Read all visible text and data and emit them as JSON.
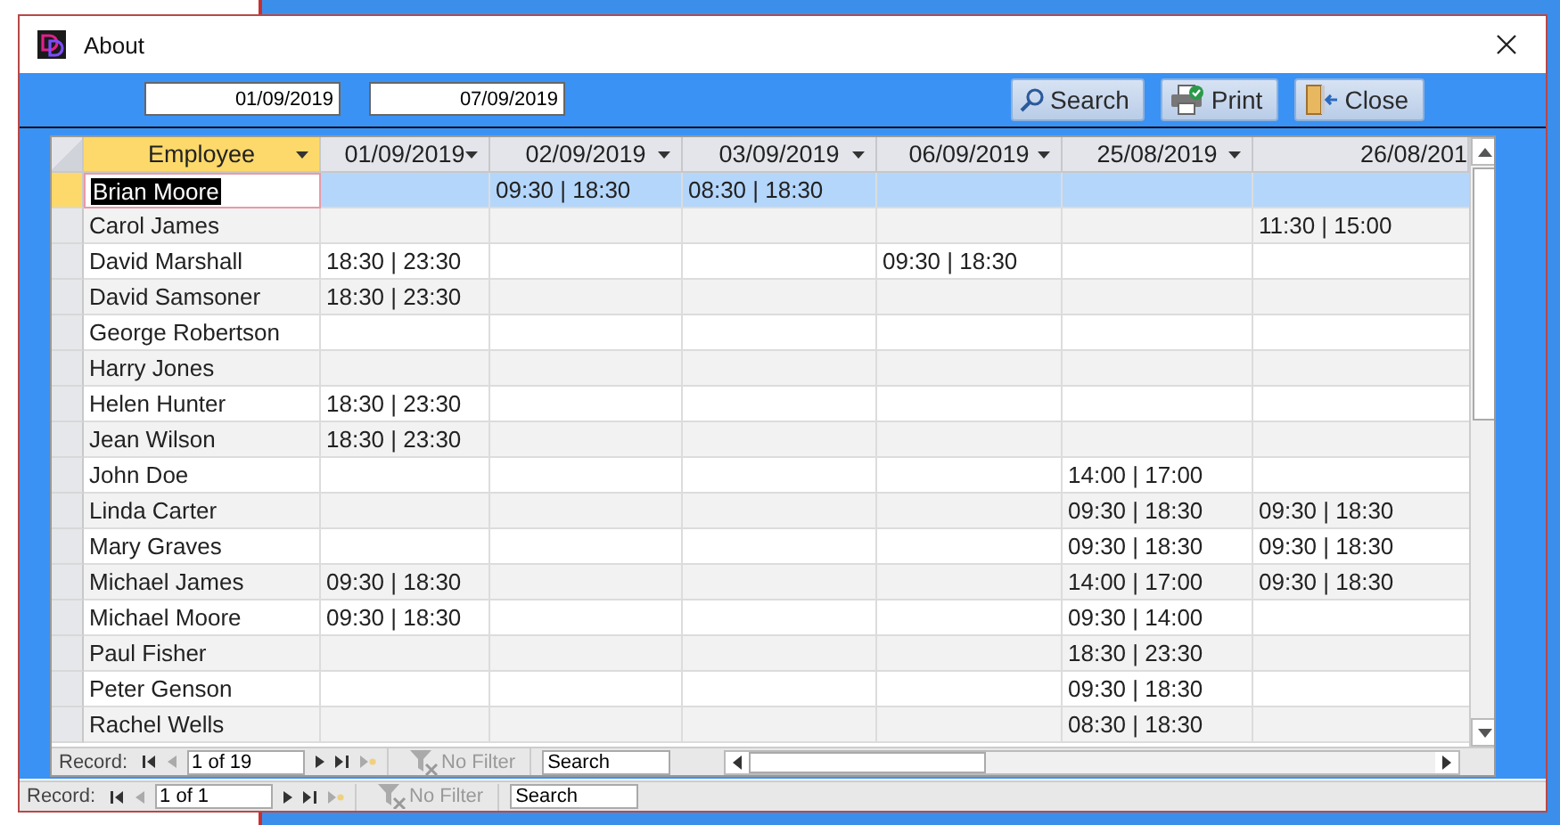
{
  "window": {
    "title": "About"
  },
  "filters": {
    "date_from": "01/09/2019",
    "date_to": "07/09/2019"
  },
  "buttons": [
    {
      "kind": "search",
      "label": "Search"
    },
    {
      "kind": "print",
      "label": "Print"
    },
    {
      "kind": "close",
      "label": "Close"
    }
  ],
  "table": {
    "columns": [
      {
        "label": "Employee",
        "selected": true,
        "dropdown": true
      },
      {
        "label": "01/09/2019",
        "selected": false,
        "dropdown": true
      },
      {
        "label": "02/09/2019",
        "selected": false,
        "dropdown": true
      },
      {
        "label": "03/09/2019",
        "selected": false,
        "dropdown": true
      },
      {
        "label": "06/09/2019",
        "selected": false,
        "dropdown": true
      },
      {
        "label": "25/08/2019",
        "selected": false,
        "dropdown": true
      },
      {
        "label": "26/08/201",
        "selected": false,
        "dropdown": false
      }
    ],
    "rows": [
      {
        "selected": true,
        "cells": [
          "Brian Moore",
          "",
          "09:30 | 18:30",
          "08:30 | 18:30",
          "",
          "",
          ""
        ]
      },
      {
        "selected": false,
        "cells": [
          "Carol James",
          "",
          "",
          "",
          "",
          "",
          "11:30 | 15:00"
        ]
      },
      {
        "selected": false,
        "cells": [
          "David Marshall",
          "18:30 | 23:30",
          "",
          "",
          "09:30 | 18:30",
          "",
          ""
        ]
      },
      {
        "selected": false,
        "cells": [
          "David Samsoner",
          "18:30 | 23:30",
          "",
          "",
          "",
          "",
          ""
        ]
      },
      {
        "selected": false,
        "cells": [
          "George Robertson",
          "",
          "",
          "",
          "",
          "",
          ""
        ]
      },
      {
        "selected": false,
        "cells": [
          "Harry Jones",
          "",
          "",
          "",
          "",
          "",
          ""
        ]
      },
      {
        "selected": false,
        "cells": [
          "Helen Hunter",
          "18:30 | 23:30",
          "",
          "",
          "",
          "",
          ""
        ]
      },
      {
        "selected": false,
        "cells": [
          "Jean Wilson",
          "18:30 | 23:30",
          "",
          "",
          "",
          "",
          ""
        ]
      },
      {
        "selected": false,
        "cells": [
          "John Doe",
          "",
          "",
          "",
          "",
          "14:00 | 17:00",
          ""
        ]
      },
      {
        "selected": false,
        "cells": [
          "Linda Carter",
          "",
          "",
          "",
          "",
          "09:30 | 18:30",
          "09:30 | 18:30"
        ]
      },
      {
        "selected": false,
        "cells": [
          "Mary Graves",
          "",
          "",
          "",
          "",
          "09:30 | 18:30",
          "09:30 | 18:30"
        ]
      },
      {
        "selected": false,
        "cells": [
          "Michael James",
          "09:30 | 18:30",
          "",
          "",
          "",
          "14:00 | 17:00",
          "09:30 | 18:30"
        ]
      },
      {
        "selected": false,
        "cells": [
          "Michael Moore",
          "09:30 | 18:30",
          "",
          "",
          "",
          "09:30 | 14:00",
          ""
        ]
      },
      {
        "selected": false,
        "cells": [
          "Paul Fisher",
          "",
          "",
          "",
          "",
          "18:30 | 23:30",
          ""
        ]
      },
      {
        "selected": false,
        "cells": [
          "Peter Genson",
          "",
          "",
          "",
          "",
          "09:30 | 18:30",
          ""
        ]
      },
      {
        "selected": false,
        "cells": [
          "Rachel Wells",
          "",
          "",
          "",
          "",
          "08:30 | 18:30",
          ""
        ]
      }
    ]
  },
  "table_navigation": {
    "label": "Record:",
    "position": "1 of 19",
    "filter": "No Filter",
    "search": "Search"
  },
  "form_navigation": {
    "label": "Record:",
    "position": "1 of 1",
    "filter": "No Filter",
    "search": "Search"
  }
}
